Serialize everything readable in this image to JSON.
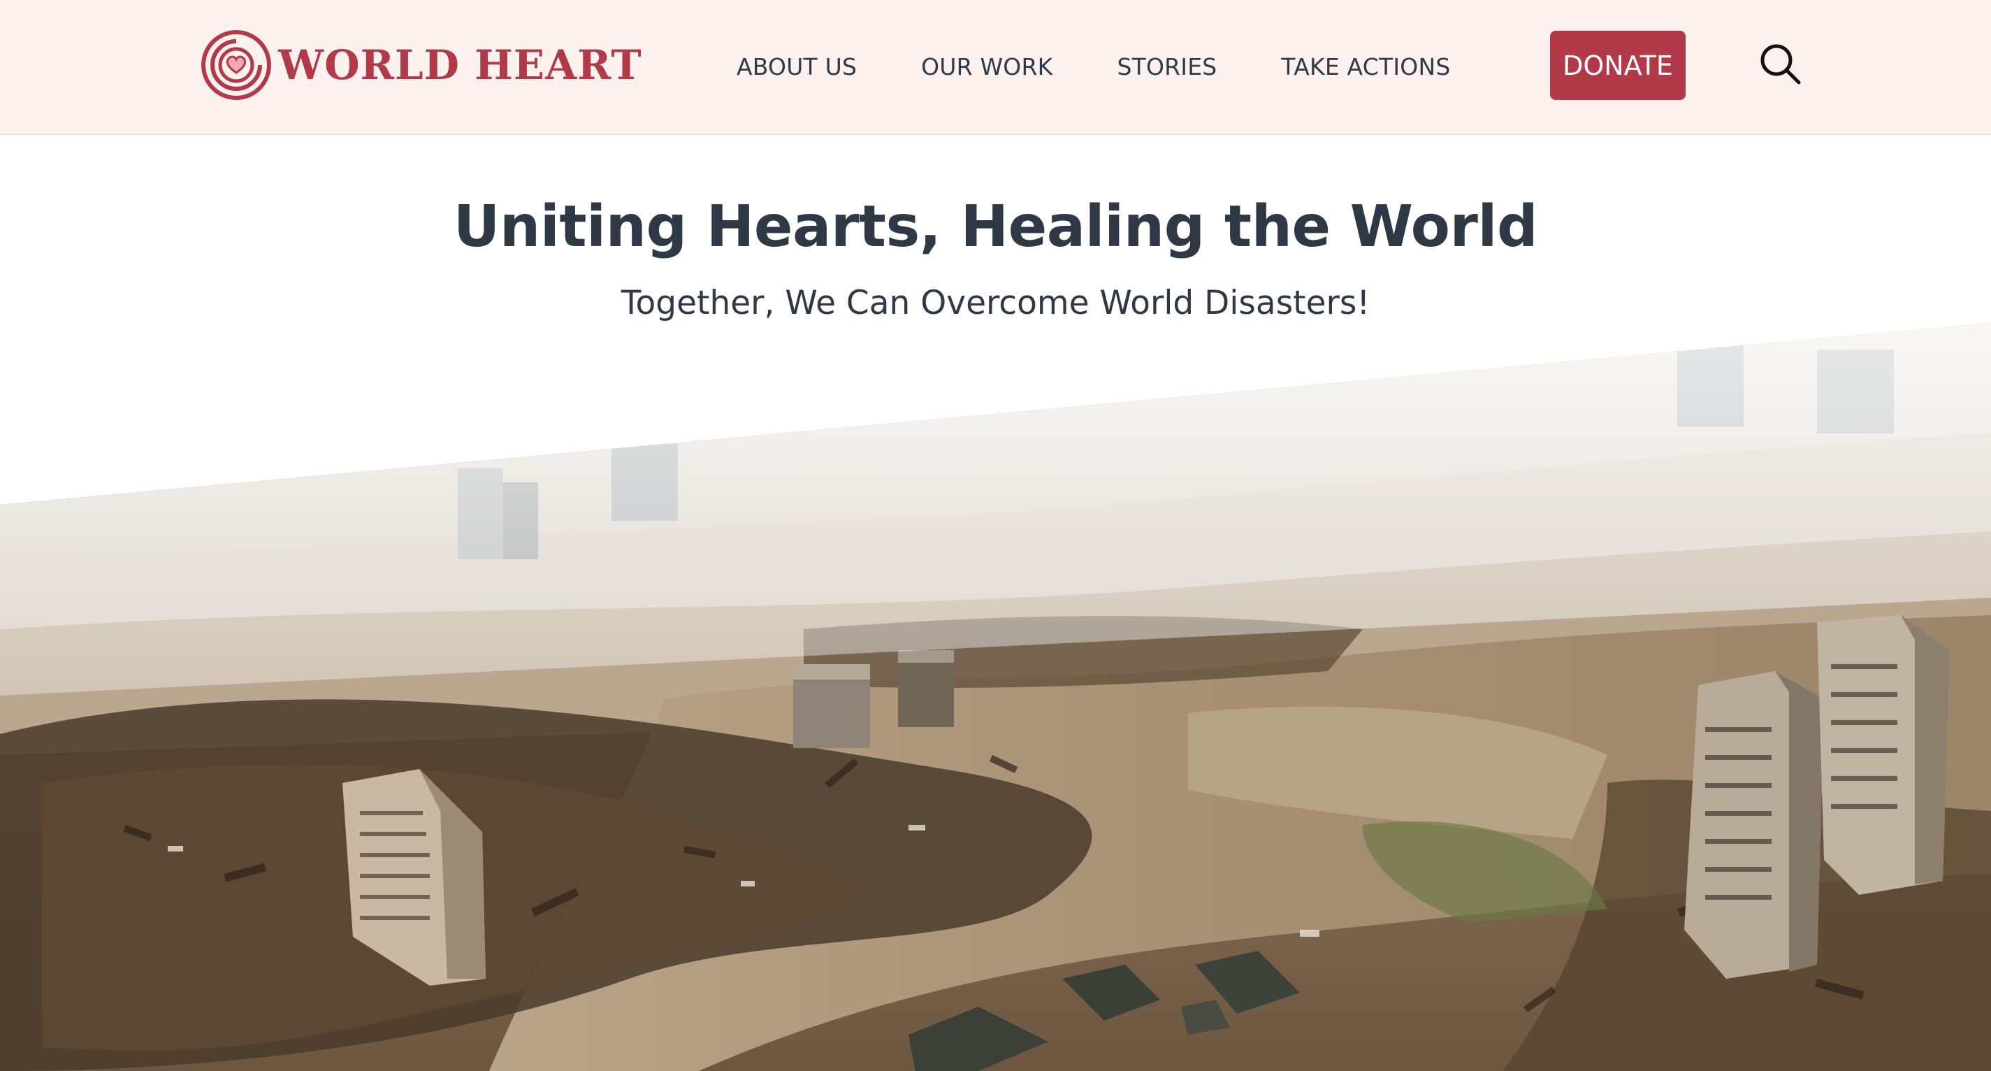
{
  "brand": {
    "name": "WORLD HEART",
    "logo_icon": "heart-target-icon",
    "color": "#b23a48"
  },
  "nav": {
    "items": [
      {
        "label": "ABOUT US"
      },
      {
        "label": "OUR WORK"
      },
      {
        "label": "STORIES"
      },
      {
        "label": "TAKE ACTIONS"
      }
    ]
  },
  "actions": {
    "donate_label": "DONATE",
    "search_icon": "search-icon"
  },
  "hero": {
    "title": "Uniting Hearts, Healing the World",
    "subtitle": "Together, We Can Overcome World Disasters!",
    "image_subject": "flooded city after disaster"
  },
  "colors": {
    "header_bg": "#fdf1ef",
    "text_dark": "#2e3945",
    "accent": "#b23a48"
  }
}
